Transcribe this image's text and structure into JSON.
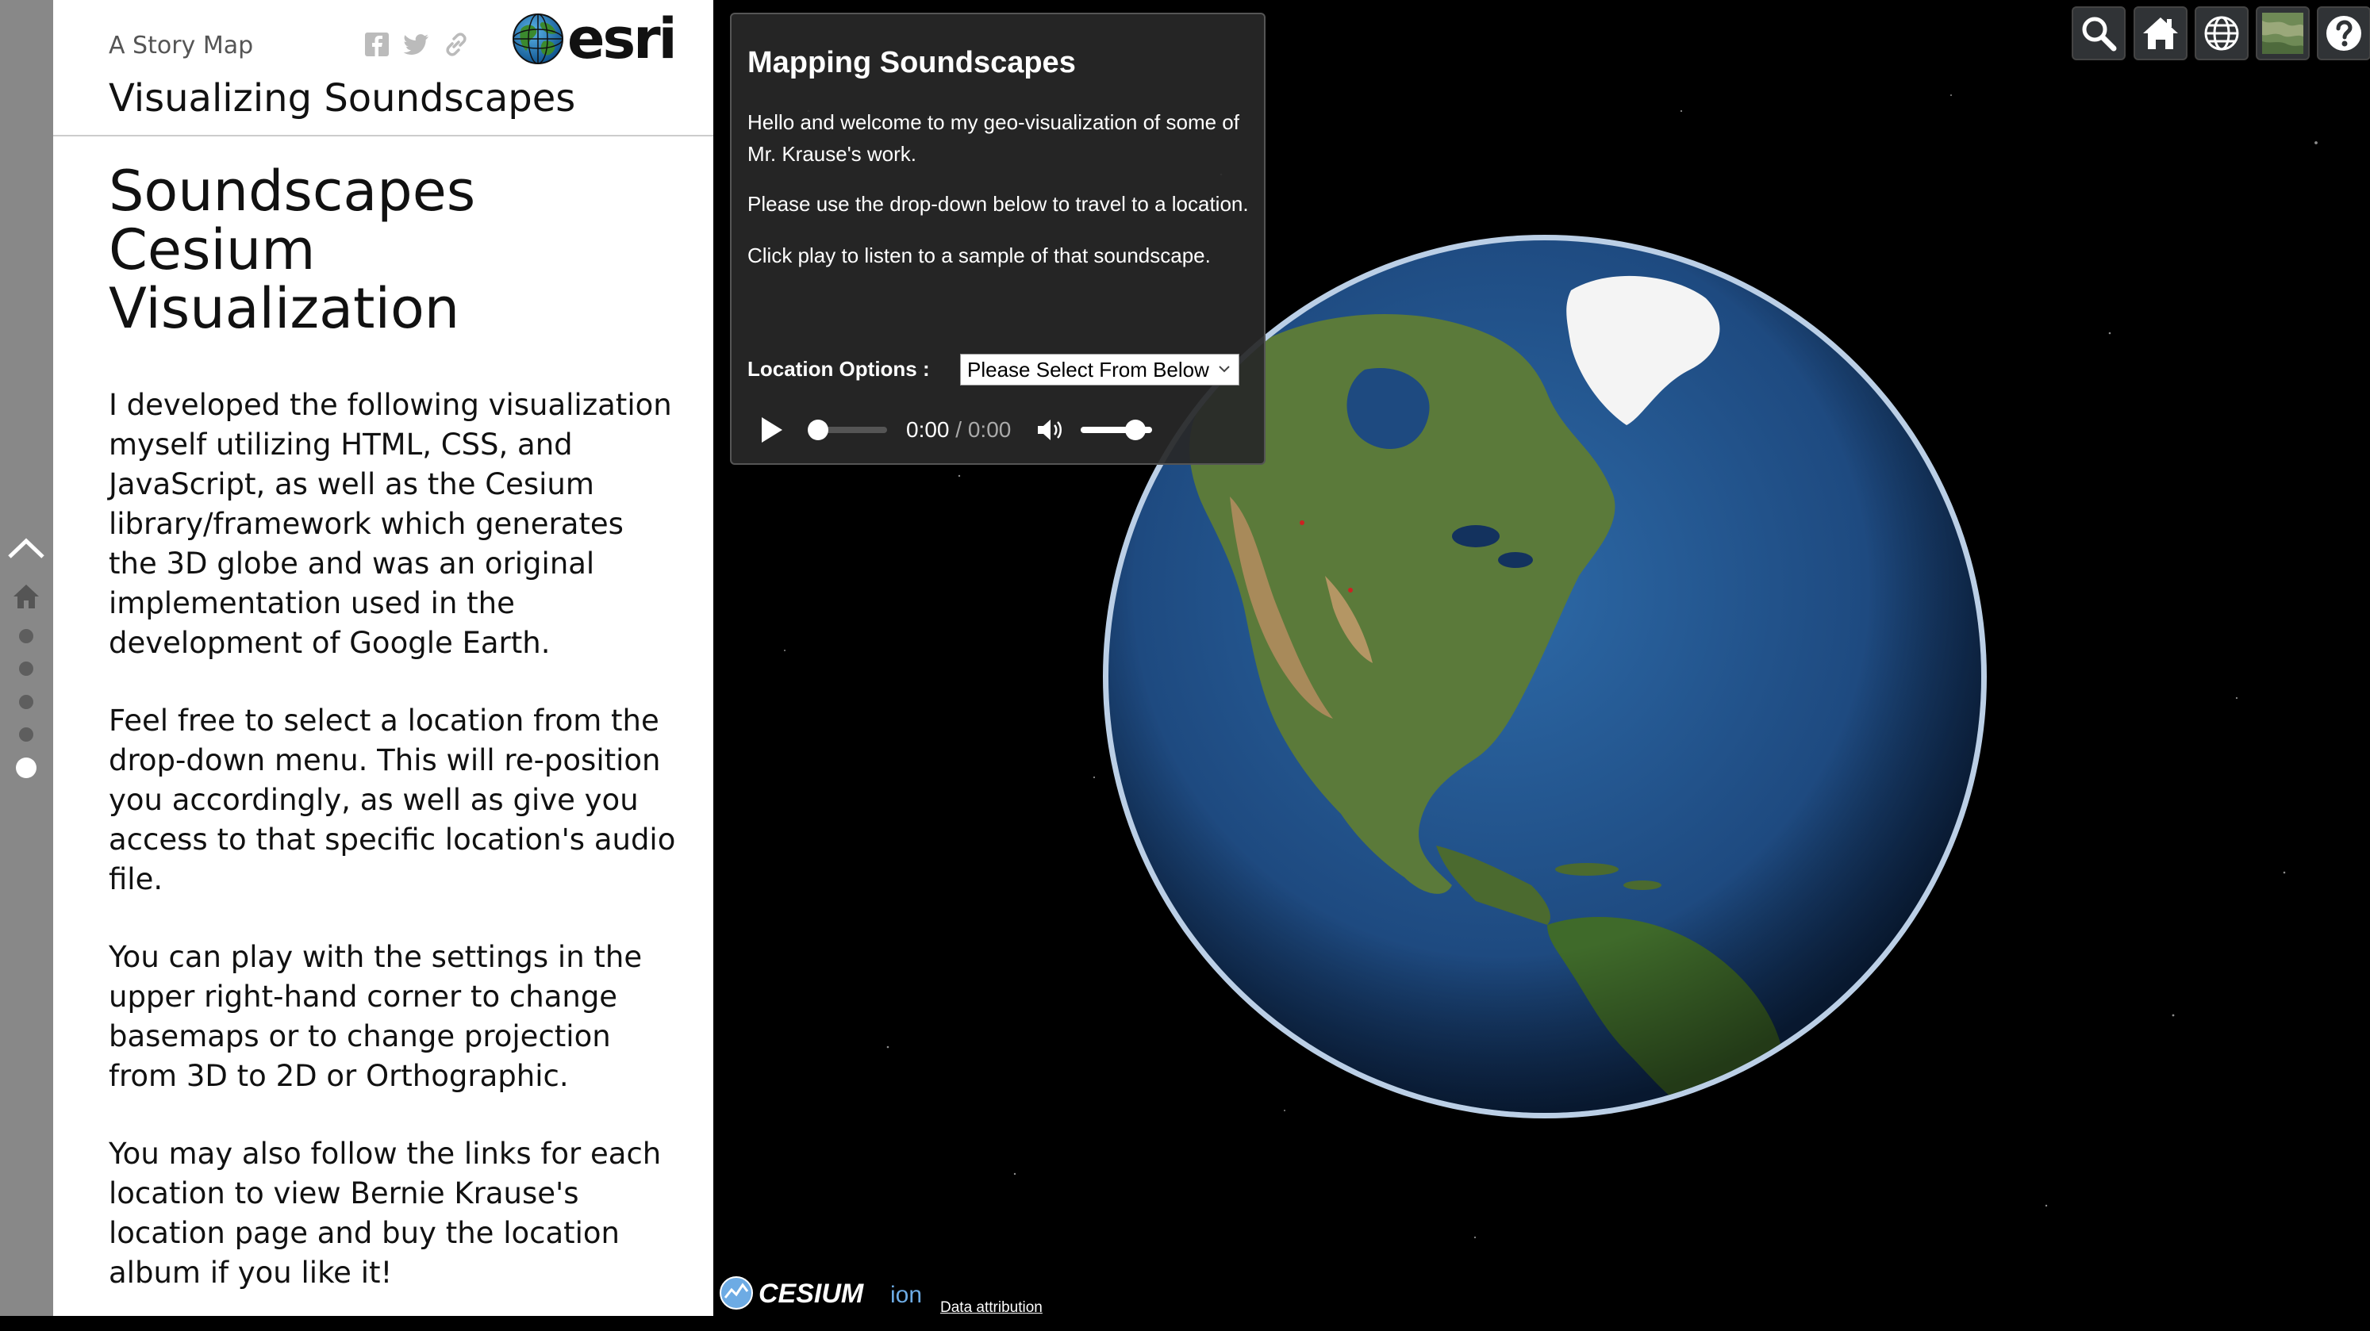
{
  "story": {
    "kicker": "A Story Map",
    "brand": "esri",
    "title": "Visualizing Soundscapes",
    "heading": "Soundscapes Cesium Visualization",
    "paragraphs": [
      "I developed the following visualization myself utilizing HTML, CSS, and JavaScript, as well as the Cesium library/framework which generates the 3D globe and was an original implementation used in the development of Google Earth.",
      "Feel free to select a location from the drop-down menu. This will re-position you accordingly, as well as give you access to that specific location's audio file.",
      "You can play with the settings in the upper right-hand corner to change basemaps or to change projection from 3D to 2D or Orthographic.",
      "You may also follow the links for each location to view Bernie Krause's location page and buy the location album if you like it!"
    ],
    "share_icons": [
      "facebook-icon",
      "twitter-icon",
      "link-icon"
    ]
  },
  "nav": {
    "dots": 5,
    "active_index": 4
  },
  "card": {
    "title": "Mapping Soundscapes",
    "messages": [
      "Hello and welcome to my geo-visualization of some of Mr. Krause's work.",
      "Please use the drop-down below to travel to a location.",
      "Click play to listen to a sample of that soundscape."
    ],
    "location_label": "Location Options :",
    "location_selected": "Please Select From Below",
    "audio": {
      "current_time": "0:00",
      "separator": " / ",
      "duration": "0:00",
      "progress": 0,
      "volume": 1.0
    }
  },
  "toolbar": {
    "buttons": [
      "search-icon",
      "home-icon",
      "globe-icon",
      "basemap-icon",
      "help-icon"
    ]
  },
  "credits": {
    "logo_text_1": "CESIUM",
    "logo_text_2": "ion",
    "attribution": "Data attribution"
  },
  "colors": {
    "rail": "#888888",
    "card_bg": "#282828",
    "toolbar_bg": "#303336",
    "ocean": "#1e4a80"
  }
}
